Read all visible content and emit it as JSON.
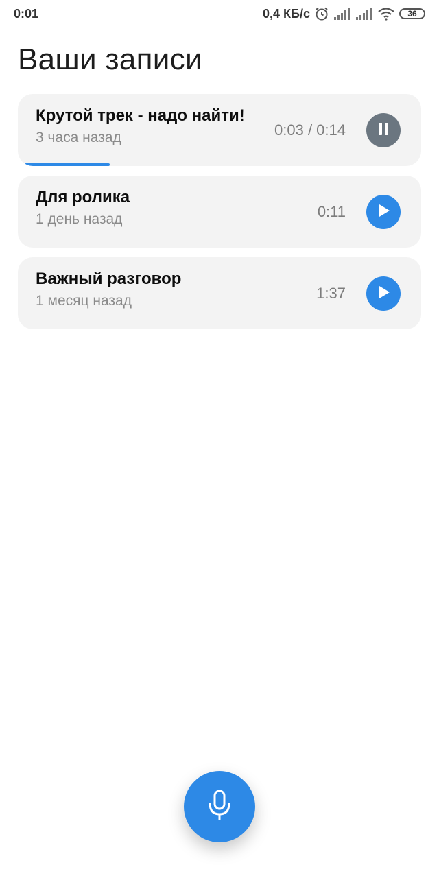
{
  "status_bar": {
    "time": "0:01",
    "speed": "0,4 КБ/с",
    "battery": "36"
  },
  "page": {
    "title": "Ваши записи"
  },
  "recordings": [
    {
      "title": "Крутой трек - надо найти!",
      "subtitle": "3 часа назад",
      "position": "0:03",
      "separator": " / ",
      "duration": "0:14",
      "state": "playing",
      "progress": 0.214
    },
    {
      "title": "Для ролика",
      "subtitle": "1 день назад",
      "duration": "0:11",
      "state": "stopped"
    },
    {
      "title": "Важный разговор",
      "subtitle": "1 месяц назад",
      "duration": "1:37",
      "state": "stopped"
    }
  ],
  "colors": {
    "accent": "#2d89e6",
    "pause_button": "#6b7680",
    "card_background": "#f3f3f3"
  },
  "icons": {
    "pause": "pause-icon",
    "play": "play-icon",
    "record": "microphone-icon"
  }
}
